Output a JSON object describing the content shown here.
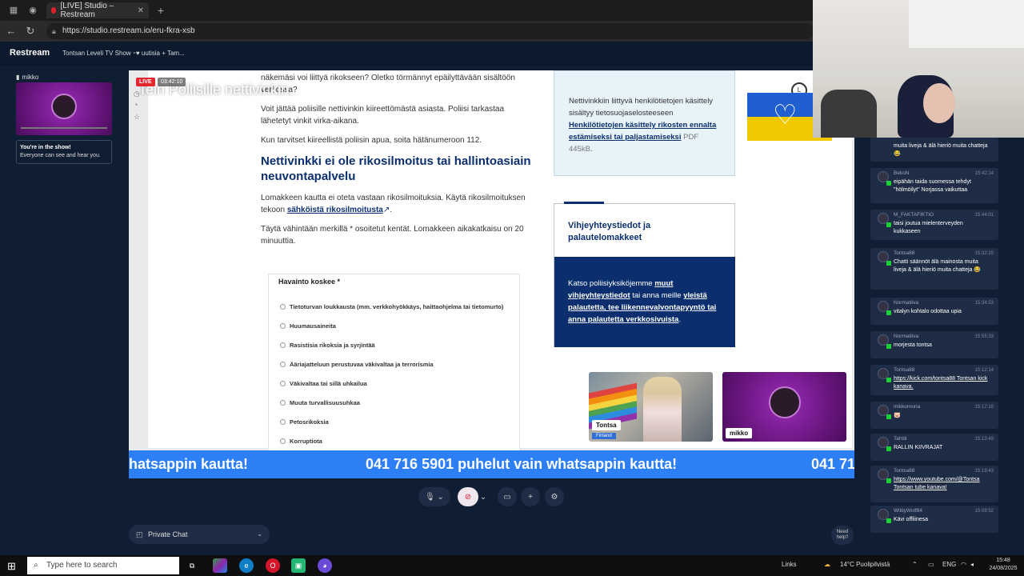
{
  "browser": {
    "tab_title": "[LIVE] Studio – Restream",
    "new_tab": "+",
    "url": "https://studio.restream.io/eru-fkra-xsb"
  },
  "restream": {
    "brand": "Restream",
    "show_title": "Tontsan Leveli TV Show ⁃♥ uutisia + Tam..."
  },
  "sidebar": {
    "cam_name": "mikko",
    "note_title": "You're in the show!",
    "note_text": "Everyone can see and hear you."
  },
  "stage": {
    "live_label": "LIVE",
    "timer": "03:42:10",
    "overlay_title": "Tein Poliisille nettivinkin.",
    "site": {
      "intro_fragment": "näkemäsi voi liittyä rikokseen? Oletko törmännyt epäilyttävään sisältöön verkossa?",
      "p1": "Voit jättää poliisille nettivinkin kiireettömästä asiasta. Poliisi tarkastaa lähetetyt vinkit virka-aikana.",
      "p2": "Kun tarvitset kiireellistä poliisin apua, soita hätänumeroon 112.",
      "heading": "Nettivinkki ei ole rikosilmoitus tai hallintoasiain neuvontapalvelu",
      "p3_before": "Lomakkeen kautta ei oteta vastaan rikosilmoituksia. Käytä rikosilmoituksen tekoon ",
      "p3_link": "sähköistä rikosilmoitusta",
      "p3_after": ".",
      "p4": "Täytä vähintään merkillä * osoitetut kentät. Lomakkeen aikakatkaisu on 20 minuuttia.",
      "form_title": "Havainto koskee *",
      "options": [
        "Tietoturvan loukkausta (mm. verkkohyökkäys, haittaohjelma tai tietomurto)",
        "Huumausaineita",
        "Rasistisia rikoksia ja syrjintää",
        "Ääriajatteluun perustuvaa väkivaltaa ja terrorismia",
        "Väkivaltaa tai sillä uhkailua",
        "Muuta turvallisuusuhkaa",
        "Petosrikoksia",
        "Korruptiota"
      ],
      "privacy_text": "Nettivinkkiin liittyvä henkilötietojen käsittely sisältyy tietosuojaselosteeseen",
      "privacy_link": "Henkilötietojen käsittely rikosten ennalta estämiseksi tai paljastamiseksi",
      "privacy_pdf": "PDF 445kB",
      "privacy_end": ".",
      "contact_title": "Vihjeyhteystiedot ja palautelomakkeet",
      "contact_t1": "Katso poliisiyksiköjemme ",
      "contact_l1": "muut vihjeyhteystiedot",
      "contact_t2": " tai anna meille ",
      "contact_l2": "yleistä palautetta, tee liikennevalvontapyyntö tai anna palautetta verkkosivuista",
      "contact_end": "."
    },
    "guests": [
      {
        "name": "Tontsa",
        "country": "Finland"
      },
      {
        "name": "mikko"
      }
    ],
    "ticker_left": "hatsappin kautta!",
    "ticker_main": "041 716 5901 puhelut vain whatsappin kautta!",
    "ticker_right": "041 71"
  },
  "bottom": {
    "chat_select": "Private Chat",
    "help": "Need help?"
  },
  "chat": [
    {
      "user": "",
      "time": "",
      "text": "muita liveja & älä hieriö muita chatteja 😂"
    },
    {
      "user": "BekoN",
      "time": "15:42:14",
      "text": "eipähän taida suomessa tehdyt \"hölmöilyt\" Norjassa vaikuttaa"
    },
    {
      "user": "M_FAKTAFIKTIO",
      "time": "15:44:01",
      "text": "taisi joutua mielenterveyden kukkaseen"
    },
    {
      "user": "Tontsa88",
      "time": "15:32:20",
      "text": "Chatti säännöt älä mainosta muita liveja & älä hieriö muita chatteja 😂"
    },
    {
      "user": "Normatiiva",
      "time": "15:34:53",
      "text": "vitalyn kohtalo odottaa upia"
    },
    {
      "user": "Normatiiva",
      "time": "15:55:33",
      "text": "morjesta tontsa"
    },
    {
      "user": "Tontsa88",
      "time": "15:12:14",
      "text": "https://kick.com/tontsa88 Tontsan kick kanava."
    },
    {
      "user": "mikkomuna",
      "time": "15:17:10",
      "text": "🐷"
    },
    {
      "user": "Tahtili",
      "time": "15:13:49",
      "text": "RALLIN KIIVRAJAT"
    },
    {
      "user": "Tontsa88",
      "time": "15:19:43",
      "text": "https://www.youtube.com/@Tontsa Tontsan tube kanava!"
    },
    {
      "user": "WildyWolf84",
      "time": "15:09:52",
      "text": "Kävi offliinesa"
    }
  ],
  "taskbar": {
    "search_placeholder": "Type here to search",
    "links": "Links",
    "weather": "14°C Puolipilvistä",
    "lang": "ENG",
    "time": "15:48",
    "date": "24/08/2025"
  },
  "colors": {
    "ticker": "#2d7ff5",
    "police_blue": "#0b2f6e",
    "live_red": "#e5262f",
    "restream_bg": "#0f1e33"
  }
}
